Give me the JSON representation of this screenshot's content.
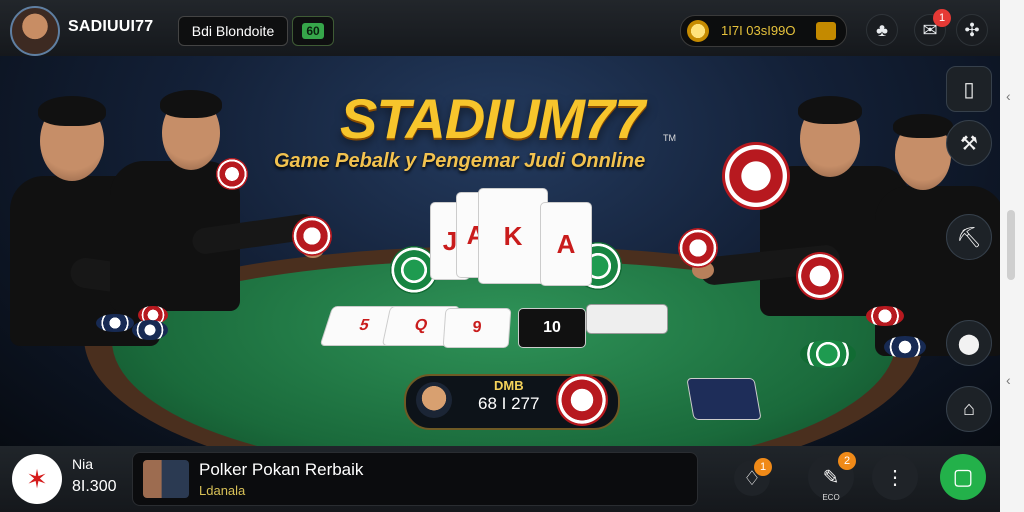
{
  "topbar": {
    "username": "SADIUUI77",
    "tag_pill": "Bdi Blondoite",
    "tag_badge": "60",
    "coins": "1I7I 03sI99O",
    "notification_count": "1"
  },
  "scene": {
    "title": "STADIUM77",
    "title_tm": "TM",
    "subtitle": "Game Pebalk y Pengemar Judi Onnline",
    "center_panel_name": "DMB",
    "center_panel_value": "68 I 277",
    "cards": [
      "J",
      "A",
      "K",
      "A",
      "5",
      "Q",
      "9",
      "10"
    ]
  },
  "sidebar": {
    "icons": [
      "door-icon",
      "hammer-icon",
      "pick-icon",
      "bag-icon",
      "home-icon"
    ]
  },
  "bottombar": {
    "bet_label": "Nia",
    "bet_value": "8I.300",
    "news_title": "Polker Pokan Rerbaik",
    "news_subtitle": "Ldanala",
    "notif_count_1": "1",
    "notif_count_2": "2",
    "mid_label": "ECO"
  }
}
